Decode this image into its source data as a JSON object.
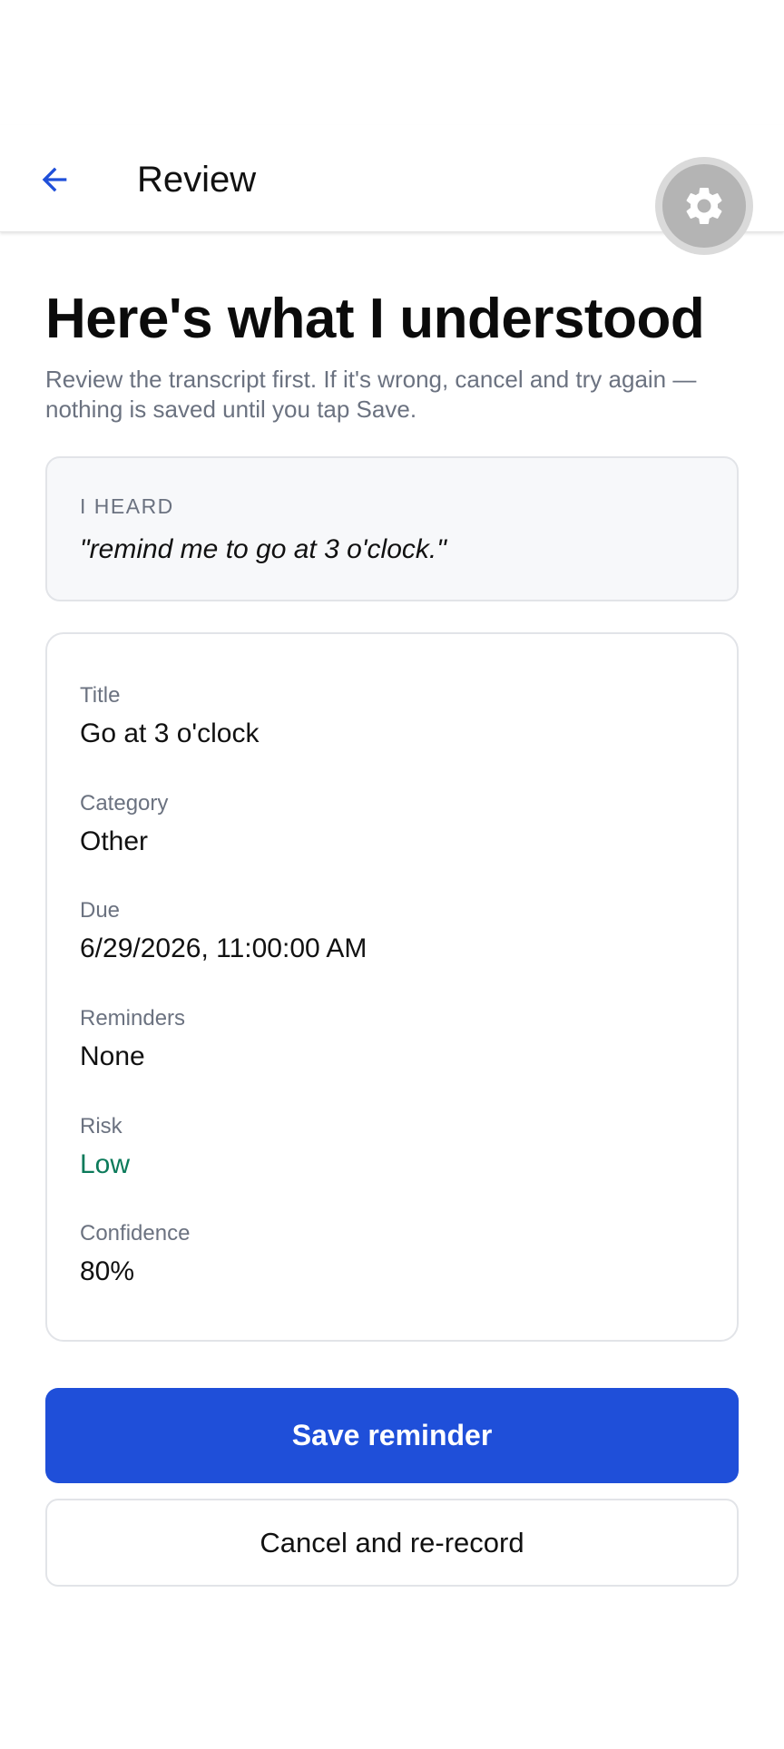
{
  "header": {
    "title": "Review",
    "back_icon": "arrow-left-icon",
    "settings_icon": "gear-icon",
    "accent_color": "#1f4fd9"
  },
  "main": {
    "heading": "Here's what I understood",
    "subtitle": "Review the transcript first. If it's wrong, cancel and try again — nothing is saved until you tap Save."
  },
  "heard": {
    "label": "I HEARD",
    "text": "\"remind me to go at 3 o'clock.\""
  },
  "details": [
    {
      "label": "Title",
      "value": "Go at 3 o'clock"
    },
    {
      "label": "Category",
      "value": "Other"
    },
    {
      "label": "Due",
      "value": "6/29/2026, 11:00:00 AM"
    },
    {
      "label": "Reminders",
      "value": "None"
    },
    {
      "label": "Risk",
      "value": "Low",
      "color": "#0b7a5a"
    },
    {
      "label": "Confidence",
      "value": "80%"
    }
  ],
  "actions": {
    "save_label": "Save reminder",
    "cancel_label": "Cancel and re-record"
  }
}
